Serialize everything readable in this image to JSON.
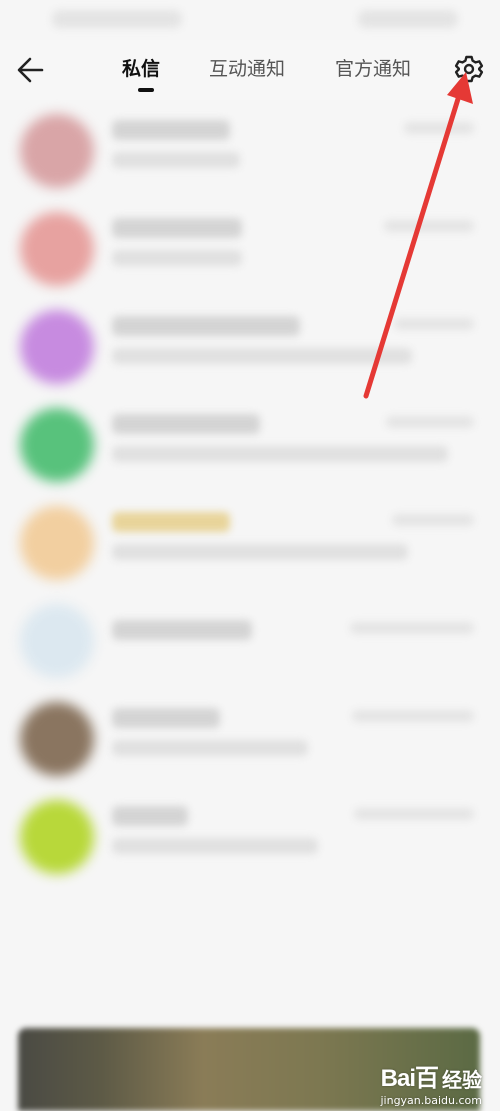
{
  "nav": {
    "tabs": [
      {
        "label": "私信",
        "active": true
      },
      {
        "label": "互动通知",
        "active": false
      },
      {
        "label": "官方通知",
        "active": false
      }
    ],
    "back_icon": "arrow-left-icon",
    "settings_icon": "gear-icon"
  },
  "annotation": {
    "color": "#e53935"
  },
  "conversations": [
    {
      "avatar_color": "#d9a5a7",
      "content": "blurred"
    },
    {
      "avatar_color": "#e7a2a0",
      "content": "blurred"
    },
    {
      "avatar_color": "#c78be0",
      "content": "blurred"
    },
    {
      "avatar_color": "#58c27c",
      "content": "blurred"
    },
    {
      "avatar_color": "#f2cfa0",
      "content": "blurred"
    },
    {
      "avatar_color": "#dce8f0",
      "content": "blurred"
    },
    {
      "avatar_color": "#8a7560",
      "content": "blurred"
    },
    {
      "avatar_color": "#b8d83a",
      "content": "blurred"
    }
  ],
  "watermark": {
    "logo": "Bai百",
    "brand": "经验",
    "url": "jingyan.baidu.com"
  }
}
